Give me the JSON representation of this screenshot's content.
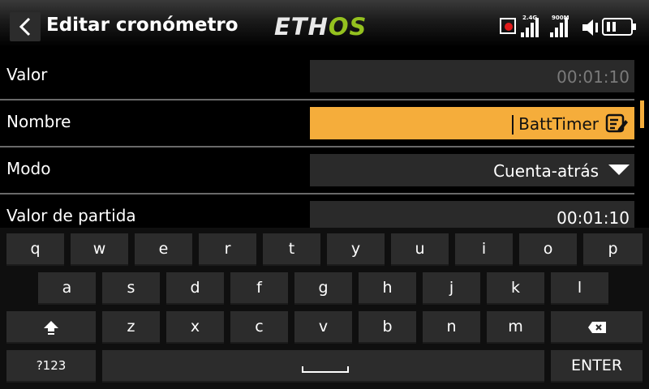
{
  "header": {
    "title": "Editar cronómetro",
    "logo_part1": "ETH",
    "logo_part2": "OS",
    "signal1_label": "2.4G",
    "signal2_label": "900M"
  },
  "rows": [
    {
      "label": "Valor",
      "value": "00:01:10"
    },
    {
      "label": "Nombre",
      "value": "BattTimer"
    },
    {
      "label": "Modo",
      "value": "Cuenta-atrás"
    },
    {
      "label": "Valor de partida",
      "value": "00:01:10"
    }
  ],
  "keyboard": {
    "row1": [
      "q",
      "w",
      "e",
      "r",
      "t",
      "y",
      "u",
      "i",
      "o",
      "p"
    ],
    "row2": [
      "a",
      "s",
      "d",
      "f",
      "g",
      "h",
      "j",
      "k",
      "l"
    ],
    "row3": [
      "z",
      "x",
      "c",
      "v",
      "b",
      "n",
      "m"
    ],
    "symbols": "?123",
    "enter": "ENTER"
  },
  "colors": {
    "accent": "#f5ad3b",
    "logo_green": "#94c11f",
    "record": "#e01b1b",
    "field_bg": "#2a2a2a",
    "key_bg": "#2c2c2c"
  },
  "icons": [
    "back-icon",
    "record-icon",
    "signal-icon",
    "speaker-icon",
    "battery-icon",
    "edit-icon",
    "chevron-down-icon",
    "shift-icon",
    "backspace-icon",
    "space-icon"
  ]
}
